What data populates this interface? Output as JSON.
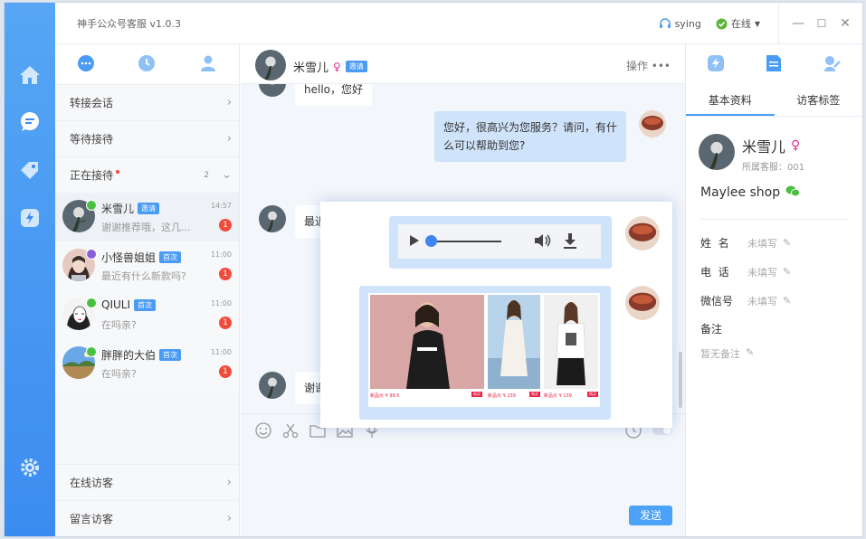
{
  "app": {
    "title": "神手公众号客服 v1.0.3",
    "user": "sying",
    "status": "在线"
  },
  "left_panel": {
    "rows": [
      "转接会话",
      "等待接待"
    ],
    "active_label": "正在接待",
    "active_count": "2",
    "conversations": [
      {
        "name": "米雪儿",
        "tag": "邀请",
        "time": "14:57",
        "message": "谢谢推荐哦，这几...",
        "badge": "1"
      },
      {
        "name": "小怪兽姐姐",
        "tag": "首次",
        "time": "11:00",
        "message": "最近有什么新款吗?",
        "badge": "1"
      },
      {
        "name": "QIULI",
        "tag": "首次",
        "time": "11:00",
        "message": "在吗亲?",
        "badge": "1"
      },
      {
        "name": "胖胖的大伯",
        "tag": "首次",
        "time": "11:00",
        "message": "在吗亲?",
        "badge": "1"
      }
    ],
    "bottom_rows": [
      "在线访客",
      "留言访客"
    ]
  },
  "chat": {
    "name": "米雪儿",
    "tag": "邀请",
    "actions": "操作 •••",
    "messages": {
      "m1": "hello，您好",
      "m2": "您好，很高兴为您服务？请问，有什么可以帮助到您?",
      "m3": "最近有什么新款上架吗?",
      "m4": "谢谢"
    },
    "send": "发送"
  },
  "right_panel": {
    "tabs": [
      "基本资料",
      "访客标签"
    ],
    "name": "米雪儿",
    "agent": "所属客服：001",
    "shop": "Maylee shop",
    "fields": [
      {
        "label": "姓  名",
        "value": "未填写"
      },
      {
        "label": "电  话",
        "value": "未填写"
      },
      {
        "label": "微信号",
        "value": "未填写"
      }
    ],
    "note_label": "备注",
    "note_value": "暂无备注"
  },
  "overlay": {
    "products": [
      {
        "price": "新品价 ¥ 99.5"
      },
      {
        "price": "新品价 ¥ 239"
      },
      {
        "price": "新品价 ¥ 139"
      }
    ],
    "buy": "购买"
  },
  "colors": {
    "accent": "#4a9bf4",
    "rail": "#3b8cf0",
    "outgoing": "#cfe3fa",
    "badge": "#f04a3a",
    "wechat": "#4ac040",
    "female": "#e0308a"
  }
}
